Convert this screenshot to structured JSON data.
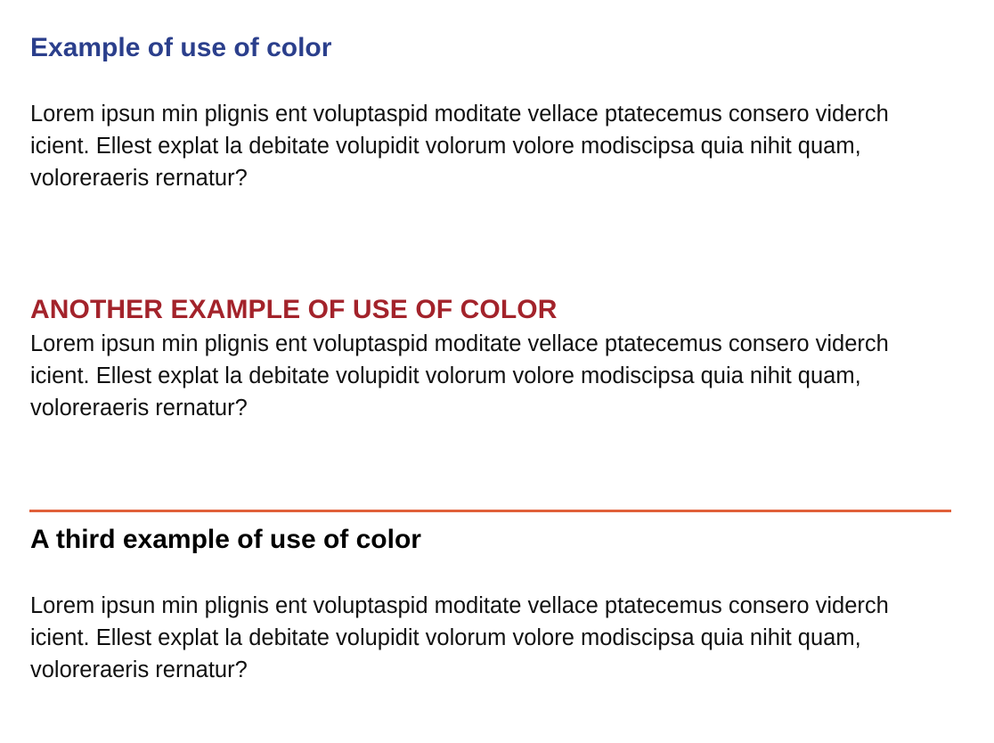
{
  "sections": [
    {
      "title": "Example of use of color",
      "title_color": "#2b3f8c",
      "body": "Lorem ipsun min plignis ent voluptaspid moditate vellace ptatecemus consero viderch icient. Ellest explat la debitate volupidit volorum volore modiscipsa quia nihit quam, voloreraeris rernatur?"
    },
    {
      "title": "ANOTHER EXAMPLE OF USE OF COLOR",
      "title_color": "#a3232b",
      "body": "Lorem ipsun min plignis ent voluptaspid moditate vellace ptatecemus consero viderch icient. Ellest explat la debitate volupidit volorum volore modiscipsa quia nihit quam, voloreraeris rernatur?"
    },
    {
      "title": "A third example of use of color",
      "title_color": "#000000",
      "rule_color": "#e0603a",
      "body": "Lorem ipsun min plignis ent voluptaspid moditate vellace ptatecemus consero viderch icient. Ellest explat la debitate volupidit volorum volore modiscipsa quia nihit quam, voloreraeris rernatur?"
    }
  ],
  "text_color": "#111111"
}
